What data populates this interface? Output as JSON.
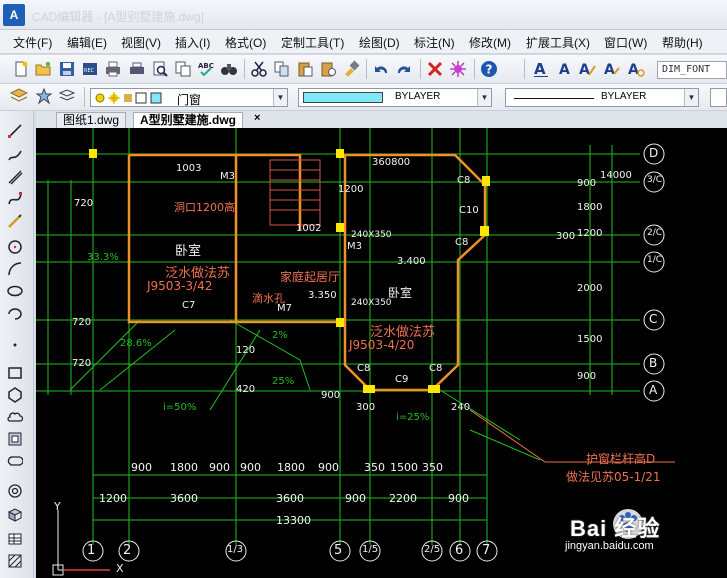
{
  "app": {
    "icon_text": "A",
    "title": "CAD编辑器 - [A型别墅建施.dwg]"
  },
  "menu": [
    "文件(F)",
    "编辑(E)",
    "视图(V)",
    "插入(I)",
    "格式(O)",
    "定制工具(T)",
    "绘图(D)",
    "标注(N)",
    "修改(M)",
    "扩展工具(X)",
    "窗口(W)",
    "帮助(H)"
  ],
  "toolbar": {
    "font_style": "DIM_FONT",
    "layer": "门窗",
    "color": "BYLAYER",
    "linetype": "BYLAYER",
    "icons": [
      "new-icon",
      "open-icon",
      "save-icon",
      "saveas-icon",
      "print-icon",
      "print-preview-icon",
      "plot-icon",
      "zoom-preview-icon",
      "copy-file-icon",
      "redo-file-icon",
      "spellcheck-icon",
      "find-icon",
      "cut-icon",
      "copy-icon",
      "paste-icon",
      "paste-special-icon",
      "match-properties-icon",
      "undo-icon",
      "redo-icon",
      "delete-icon",
      "erase-icon",
      "help-icon",
      "text-icon",
      "text-style-icon",
      "text-edit-icon",
      "text-find-icon"
    ]
  },
  "tabs": [
    {
      "label": "图纸1.dwg",
      "active": false
    },
    {
      "label": "A型别墅建施.dwg",
      "active": true
    }
  ],
  "tab_close": "×",
  "drawing": {
    "room_labels": [
      "卧室",
      "泛水做法苏",
      "J9503-3/42",
      "家庭起居厅",
      "卧室",
      "泛水做法苏",
      "J9503-4/20",
      "滴水孔",
      "洞口1200高"
    ],
    "window_labels": [
      "C7",
      "M3",
      "M3",
      "M7",
      "C8",
      "C10",
      "C8",
      "C8",
      "C9",
      "C8",
      "C7"
    ],
    "dims_top": [
      "900",
      "1800",
      "900",
      "900",
      "1800",
      "900",
      "350",
      "1500",
      "350"
    ],
    "dims_middle": [
      "1200",
      "3600",
      "3600",
      "900",
      "2200",
      "900"
    ],
    "dims_total": "13300",
    "axis_bottom": [
      "1",
      "2",
      "1/3",
      "5",
      "1/5",
      "2/5",
      "6",
      "7"
    ],
    "axis_right": [
      "D",
      "3/C",
      "2/C",
      "1/C",
      "C",
      "B",
      "A"
    ],
    "right_dims": [
      "14000",
      "900",
      "1800",
      "1200",
      "2000",
      "1500",
      "900",
      "300"
    ],
    "elevations": [
      "3.400",
      "3.350"
    ],
    "slopes": [
      "33.3%",
      "28.6%",
      "i=50%",
      "i=25%",
      "2%",
      "25%"
    ],
    "misc_dims": [
      "720",
      "720",
      "720",
      "120",
      "420",
      "1200",
      "1003",
      "1002",
      "360800",
      "240X350",
      "240X350",
      "900",
      "300",
      "240"
    ],
    "callout": [
      "护窗栏杆高D",
      "做法见苏05-1/21"
    ],
    "ucs": {
      "y": "Y",
      "x": "X"
    }
  },
  "watermark": {
    "brand": "Bai 经验",
    "url": "jingyan.baidu.com"
  }
}
